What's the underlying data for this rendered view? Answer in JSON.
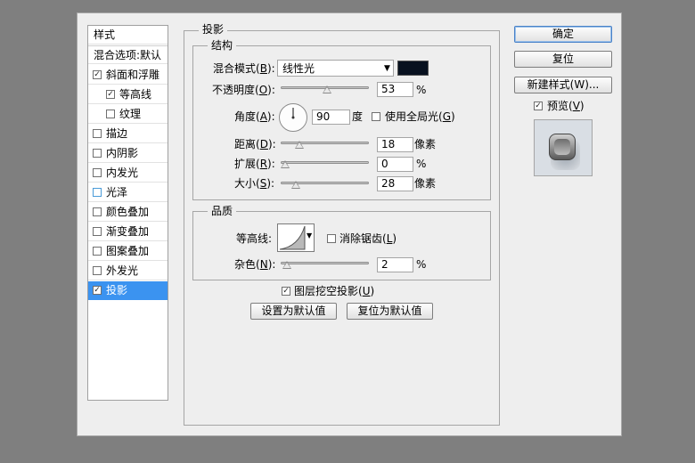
{
  "styles_panel": {
    "header": "样式",
    "blend_options": "混合选项:默认",
    "items": [
      {
        "label": "斜面和浮雕",
        "checked": true
      },
      {
        "label": "等高线",
        "checked": true
      },
      {
        "label": "纹理",
        "checked": false
      },
      {
        "label": "描边",
        "checked": false
      },
      {
        "label": "内阴影",
        "checked": false
      },
      {
        "label": "内发光",
        "checked": false
      },
      {
        "label": "光泽",
        "checked": false
      },
      {
        "label": "颜色叠加",
        "checked": false
      },
      {
        "label": "渐变叠加",
        "checked": false
      },
      {
        "label": "图案叠加",
        "checked": false
      },
      {
        "label": "外发光",
        "checked": false
      },
      {
        "label": "投影",
        "checked": true,
        "selected": true
      }
    ]
  },
  "main": {
    "section_title": "投影",
    "structure": {
      "title": "结构",
      "blend_mode": {
        "label": "混合模式",
        "key": "B",
        "value": "线性光",
        "color": "#08111f"
      },
      "opacity": {
        "label": "不透明度",
        "key": "O",
        "value": "53",
        "unit": "%",
        "level": 0.53
      },
      "angle": {
        "label": "角度",
        "key": "A",
        "value": "90",
        "unit": "度",
        "degrees": 90
      },
      "global_light": {
        "label": "使用全局光",
        "key": "G",
        "checked": false
      },
      "distance": {
        "label": "距离",
        "key": "D",
        "value": "18",
        "unit": "像素",
        "level": 0.18
      },
      "spread": {
        "label": "扩展",
        "key": "R",
        "value": "0",
        "unit": "%",
        "level": 0
      },
      "size": {
        "label": "大小",
        "key": "S",
        "value": "28",
        "unit": "像素",
        "level": 0.14
      }
    },
    "quality": {
      "title": "品质",
      "contour": {
        "label": "等高线:"
      },
      "anti_alias": {
        "label": "消除锯齿",
        "key": "L",
        "checked": false
      },
      "noise": {
        "label": "杂色",
        "key": "N",
        "value": "2",
        "unit": "%",
        "level": 0.02
      }
    },
    "knockout": {
      "label": "图层挖空投影",
      "key": "U",
      "checked": true
    },
    "make_default": "设置为默认值",
    "reset_default": "复位为默认值"
  },
  "buttons": {
    "ok": "确定",
    "reset": "复位",
    "new_style": "新建样式(W)...",
    "preview": {
      "label": "预览",
      "key": "V",
      "checked": true
    }
  }
}
